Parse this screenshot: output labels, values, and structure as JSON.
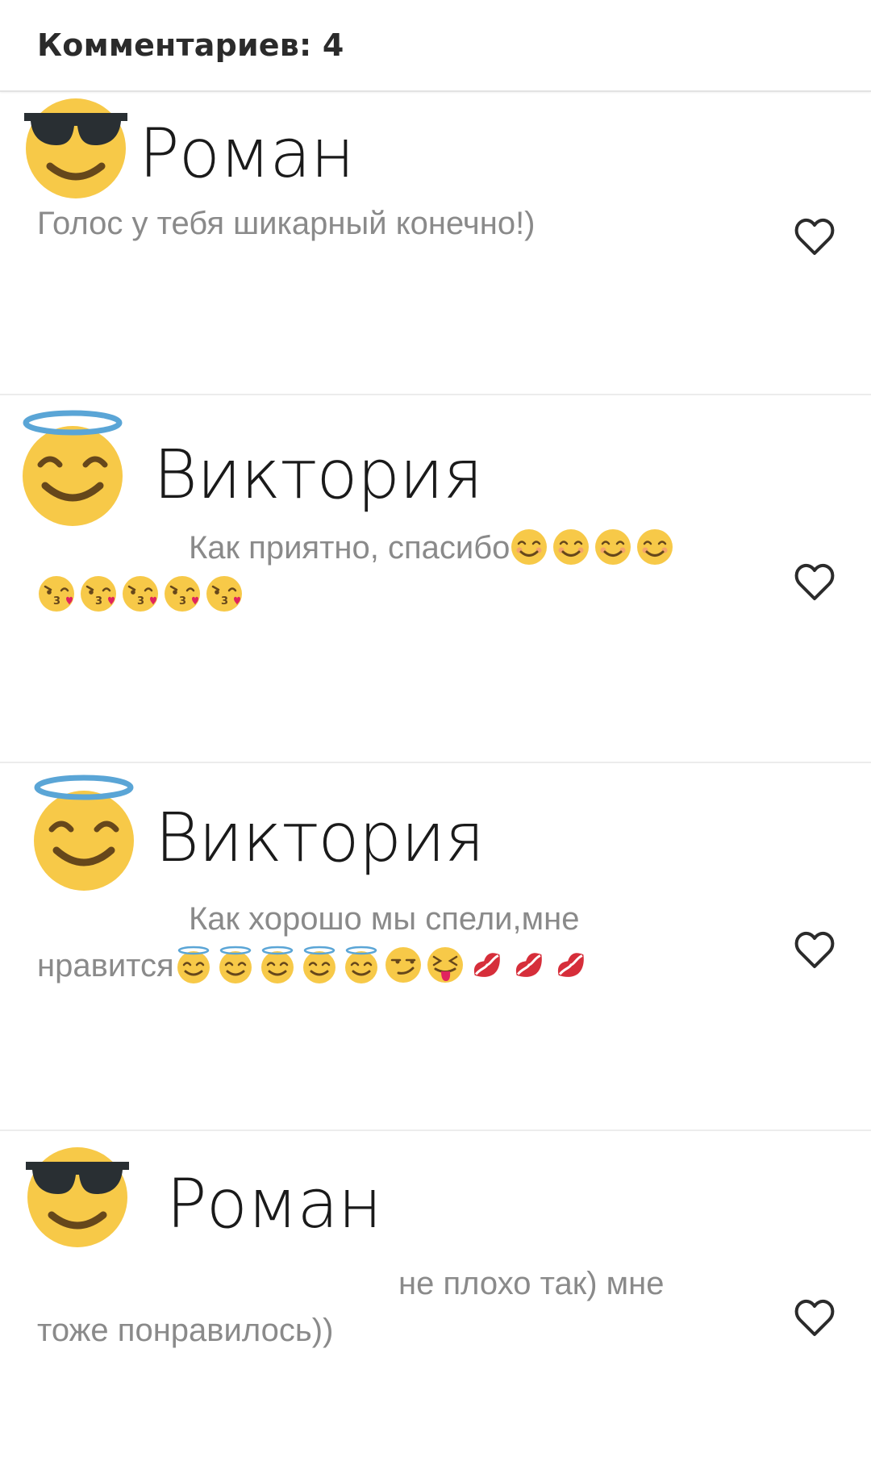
{
  "header": {
    "title": "Комментариев: 4"
  },
  "comments": [
    {
      "author": "Роман",
      "avatar_icon": "sunglasses-face-icon",
      "lines": [
        "Голос у тебя шикарный конечно!)"
      ]
    },
    {
      "author": "Виктория",
      "avatar_icon": "halo-face-icon",
      "lines": [
        "Как приятно, спасибо",
        ""
      ]
    },
    {
      "author": "Виктория",
      "avatar_icon": "halo-face-icon",
      "lines": [
        "Как хорошо мы спели,мне",
        "нравится"
      ]
    },
    {
      "author": "Роман",
      "avatar_icon": "sunglasses-face-icon",
      "lines": [
        "не плохо так) мне",
        "тоже понравилось))"
      ]
    }
  ],
  "colors": {
    "emoji_yellow": "#f7c948",
    "emoji_dark": "#66471b",
    "halo_blue": "#5aa5d6",
    "text_gray": "#8a8a8a",
    "name_black": "#1a1a1a",
    "lips_red": "#d62e3a"
  }
}
